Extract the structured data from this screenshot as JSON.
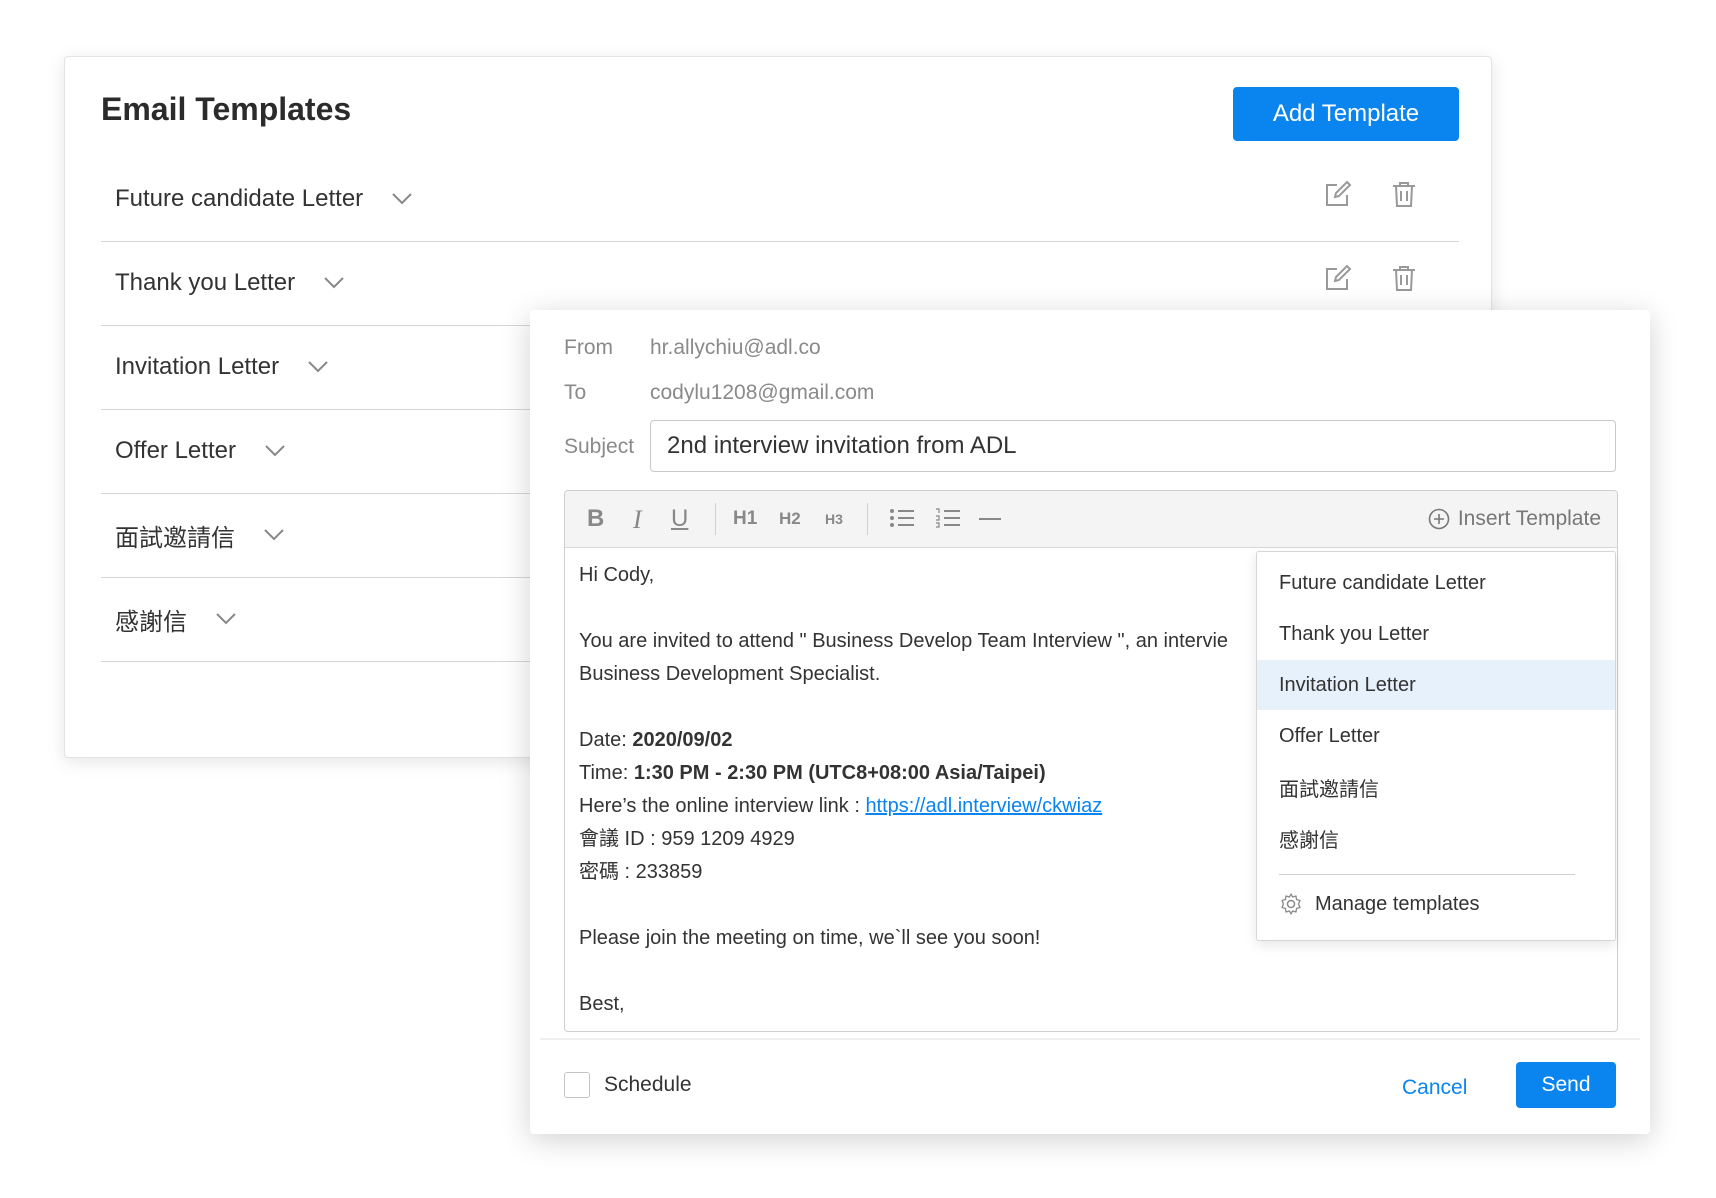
{
  "templates_panel": {
    "title": "Email Templates",
    "add_button": "Add Template",
    "templates": [
      {
        "name": "Future candidate Letter"
      },
      {
        "name": "Thank you Letter"
      },
      {
        "name": "Invitation Letter"
      },
      {
        "name": "Offer Letter"
      },
      {
        "name": "面試邀請信"
      },
      {
        "name": "感謝信"
      }
    ]
  },
  "compose": {
    "from_label": "From",
    "from_value": "hr.allychiu@adl.co",
    "to_label": "To",
    "to_value": "codylu1208@gmail.com",
    "subject_label": "Subject",
    "subject_value": "2nd interview invitation from ADL",
    "toolbar": {
      "bold": "B",
      "italic": "I",
      "underline": "U",
      "h1": "H1",
      "h2": "H2",
      "h3": "H3",
      "insert_template": "Insert Template"
    },
    "body": {
      "greeting": "Hi Cody,",
      "line1": "You are invited to attend \" Business Develop Team Interview \", an intervie",
      "line2": "Business Development Specialist.",
      "date_label": "Date: ",
      "date_value": "2020/09/02",
      "time_label": "Time: ",
      "time_value": "1:30 PM - 2:30 PM (UTC8+08:00 Asia/Taipei)",
      "link_label": "Here’s the online interview link : ",
      "link_value": "https://adl.interview/ckwiaz",
      "meeting_id": "會議 ID : 959 1209 4929",
      "password": "密碼 : 233859",
      "closing": "Please join the meeting on time, we`ll see you soon!",
      "signoff": "Best,"
    },
    "dropdown": {
      "items": [
        {
          "label": "Future candidate Letter"
        },
        {
          "label": "Thank you Letter"
        },
        {
          "label": "Invitation Letter"
        },
        {
          "label": "Offer Letter"
        },
        {
          "label": "面試邀請信"
        },
        {
          "label": "感謝信"
        }
      ],
      "manage": "Manage templates"
    },
    "schedule_label": "Schedule",
    "cancel": "Cancel",
    "send": "Send"
  },
  "colors": {
    "accent": "#0a84ef",
    "highlight": "#e6f1fc"
  }
}
